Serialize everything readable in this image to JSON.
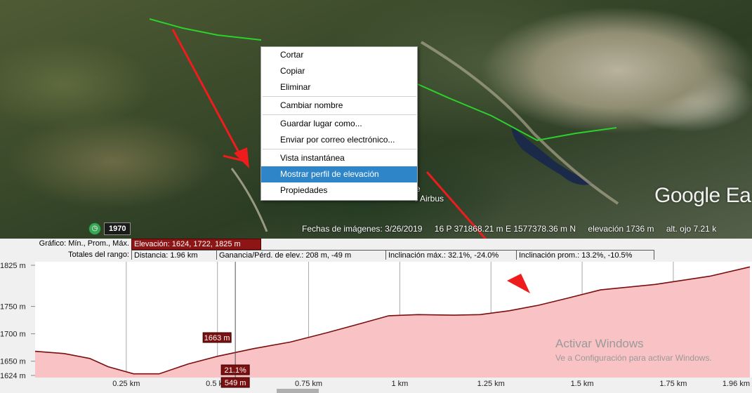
{
  "map": {
    "attribution": "/ Airbus",
    "attribution_prefix": "e",
    "brand": "Google Ea",
    "history_year": "1970",
    "status": {
      "imagery_date": "Fechas de imágenes: 3/26/2019",
      "coords": "16 P 371868.21 m E 1577378.36 m N",
      "elevation": "elevación   1736 m",
      "eye_alt": "alt. ojo   7.21 k"
    }
  },
  "context_menu": {
    "items": [
      {
        "label": "Cortar"
      },
      {
        "label": "Copiar"
      },
      {
        "label": "Eliminar"
      },
      {
        "label": "Cambiar nombre"
      },
      {
        "label": "Guardar lugar como..."
      },
      {
        "label": "Enviar por correo electrónico..."
      },
      {
        "label": "Vista instantánea"
      },
      {
        "label": "Mostrar perfil de elevación"
      },
      {
        "label": "Propiedades"
      }
    ],
    "active_index": 7
  },
  "elevation_panel": {
    "row1_label": "Gráfico: Mín., Prom., Máx.",
    "elevation_field": "Elevación: 1624, 1722, 1825 m",
    "row2_label": "Totales del rango:",
    "distance_field": "Distancia: 1.96 km",
    "gain_field": "Ganancia/Pérd. de elev.: 208 m, -49 m",
    "max_slope_field": "Inclinación máx.: 32.1%, -24.0%",
    "avg_slope_field": "Inclinación prom.: 13.2%, -10.5%"
  },
  "cursor": {
    "elevation_label": "1663 m",
    "slope_label": "21.1%",
    "distance_label": "549 m"
  },
  "chart_data": {
    "type": "area",
    "x_unit": "km",
    "xlim": [
      0,
      1.96
    ],
    "ylim": [
      1624,
      1825
    ],
    "x_ticks": [
      {
        "value": 0.25,
        "label": "0.25 km"
      },
      {
        "value": 0.5,
        "label": "0.5 km"
      },
      {
        "value": 0.75,
        "label": "0.75 km"
      },
      {
        "value": 1.0,
        "label": "1 km"
      },
      {
        "value": 1.25,
        "label": "1.25 km"
      },
      {
        "value": 1.5,
        "label": "1.5 km"
      },
      {
        "value": 1.75,
        "label": "1.75 km"
      },
      {
        "value": 1.96,
        "label": "1.96 km"
      }
    ],
    "y_ticks": [
      {
        "value": 1825,
        "label": "1825 m"
      },
      {
        "value": 1750,
        "label": "1750 m"
      },
      {
        "value": 1700,
        "label": "1700 m"
      },
      {
        "value": 1650,
        "label": "1650 m"
      },
      {
        "value": 1624,
        "label": "1624 m"
      }
    ],
    "x": [
      0,
      0.08,
      0.15,
      0.2,
      0.27,
      0.34,
      0.42,
      0.5,
      0.55,
      0.6,
      0.7,
      0.8,
      0.9,
      0.97,
      1.05,
      1.15,
      1.22,
      1.3,
      1.38,
      1.46,
      1.55,
      1.7,
      1.85,
      1.96
    ],
    "y": [
      1668,
      1664,
      1655,
      1640,
      1627,
      1627,
      1645,
      1659,
      1666,
      1673,
      1685,
      1702,
      1720,
      1733,
      1735,
      1734,
      1735,
      1742,
      1752,
      1765,
      1780,
      1790,
      1805,
      1822
    ],
    "cursor_x": 0.549
  },
  "watermark": {
    "line1": "Activar Windows",
    "line2": "Ve a Configuración para activar Windows."
  }
}
